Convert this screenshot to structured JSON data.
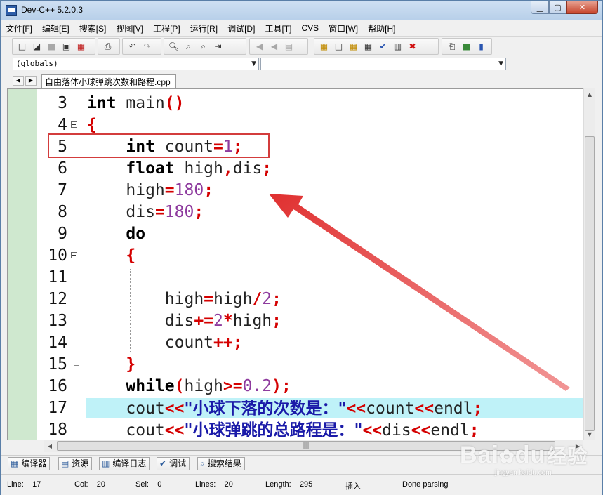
{
  "window": {
    "title": "Dev-C++ 5.2.0.3"
  },
  "menu": [
    "文件[F]",
    "编辑[E]",
    "搜索[S]",
    "视图[V]",
    "工程[P]",
    "运行[R]",
    "调试[D]",
    "工具[T]",
    "CVS",
    "窗口[W]",
    "帮助[H]"
  ],
  "combos": {
    "left_value": "(globals)",
    "right_value": ""
  },
  "tab": {
    "label": "自由落体小球弹跳次数和路程.cpp"
  },
  "editor": {
    "highlighted_line": "17",
    "lines": [
      {
        "n": "3",
        "code": "int main()"
      },
      {
        "n": "4",
        "code": "{"
      },
      {
        "n": "5",
        "code": "    int count=1;"
      },
      {
        "n": "6",
        "code": "    float high,dis;"
      },
      {
        "n": "7",
        "code": "    high=180;"
      },
      {
        "n": "8",
        "code": "    dis=180;"
      },
      {
        "n": "9",
        "code": "    do"
      },
      {
        "n": "10",
        "code": "    {"
      },
      {
        "n": "11",
        "code": ""
      },
      {
        "n": "12",
        "code": "        high=high/2;"
      },
      {
        "n": "13",
        "code": "        dis+=2*high;"
      },
      {
        "n": "14",
        "code": "        count++;"
      },
      {
        "n": "15",
        "code": "    }"
      },
      {
        "n": "16",
        "code": "    while(high>=0.2);"
      },
      {
        "n": "17",
        "code": "    cout<<\"小球下落的次数是：\"<<count<<endl;"
      },
      {
        "n": "18",
        "code": "    cout<<\"小球弹跳的总路程是：\"<<dis<<endl;"
      }
    ]
  },
  "bottom_tabs": [
    {
      "label": "编译器",
      "icon": "grid-icon"
    },
    {
      "label": "资源",
      "icon": "resources-icon"
    },
    {
      "label": "编译日志",
      "icon": "chart-icon"
    },
    {
      "label": "调试",
      "icon": "check-icon"
    },
    {
      "label": "搜索结果",
      "icon": "magnifier-icon"
    }
  ],
  "status": {
    "line_label": "Line:",
    "line_value": "17",
    "col_label": "Col:",
    "col_value": "20",
    "sel_label": "Sel:",
    "sel_value": "0",
    "lines_label": "Lines:",
    "lines_value": "20",
    "length_label": "Length:",
    "length_value": "295",
    "mode": "插入",
    "message": "Done parsing"
  },
  "watermark": {
    "brand": "Bai",
    "brand2": "du",
    "cn": "经验",
    "url": "jingyan.baidu.com"
  },
  "colors": {
    "keyword": "#000000",
    "operator": "#d40000",
    "number": "#8e3b9e",
    "string": "#1a1aa8",
    "highlight": "#bff2f8",
    "annotation": "#d33c3c"
  }
}
